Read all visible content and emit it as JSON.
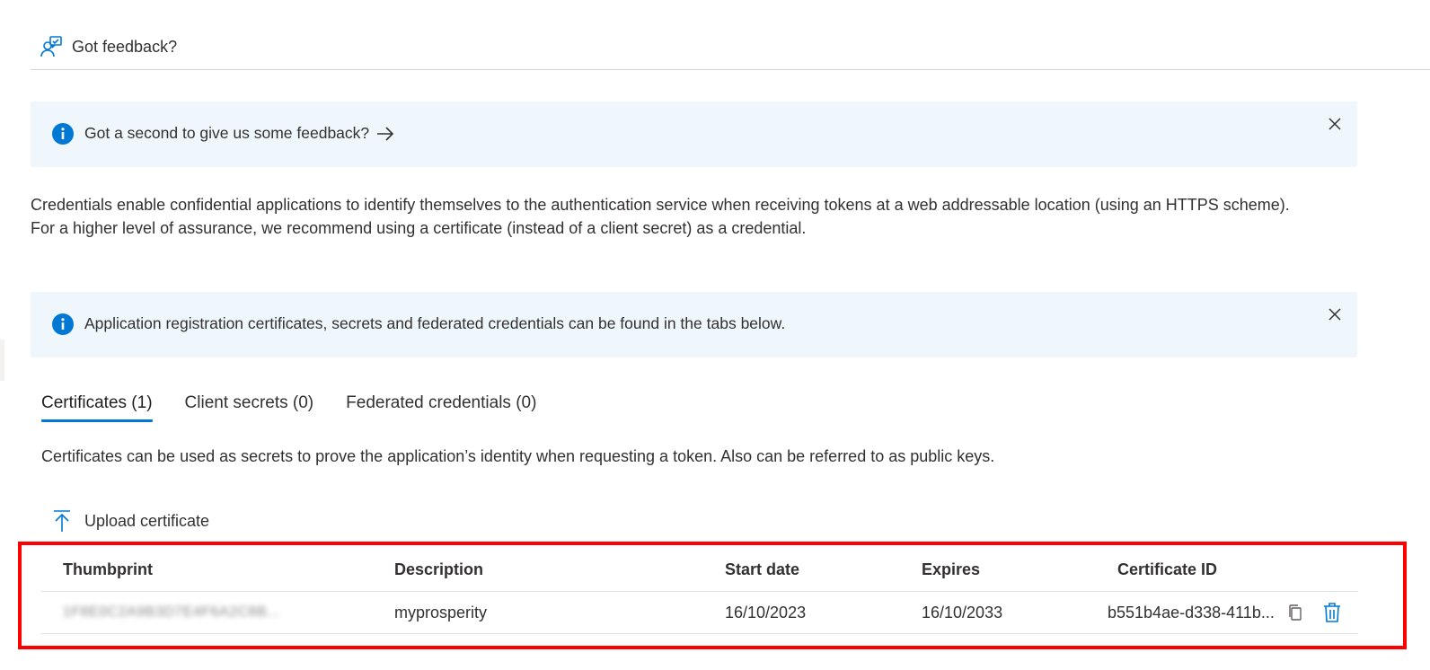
{
  "commandbar": {
    "feedback_label": "Got feedback?"
  },
  "banners": {
    "feedback": {
      "message": "Got a second to give us some feedback?"
    },
    "info": {
      "message": "Application registration certificates, secrets and federated credentials can be found in the tabs below."
    }
  },
  "intro_text": "Credentials enable confidential applications to identify themselves to the authentication service when receiving tokens at a web addressable location (using an HTTPS scheme). For a higher level of assurance, we recommend using a certificate (instead of a client secret) as a credential.",
  "tabs": [
    {
      "label": "Certificates (1)",
      "active": true
    },
    {
      "label": "Client secrets (0)",
      "active": false
    },
    {
      "label": "Federated credentials (0)",
      "active": false
    }
  ],
  "certificates": {
    "description_text": "Certificates can be used as secrets to prove the application’s identity when requesting a token. Also can be referred to as public keys.",
    "upload_label": "Upload certificate",
    "columns": {
      "thumbprint": "Thumbprint",
      "description": "Description",
      "start_date": "Start date",
      "expires": "Expires",
      "certificate_id": "Certificate ID"
    },
    "rows": [
      {
        "thumbprint_masked": "1F8E0C2A9B3D7E4F6A2C8B...",
        "thumbprint_ellipsis": "...",
        "description": "myprosperity",
        "start_date": "16/10/2023",
        "expires": "16/10/2033",
        "certificate_id": "b551b4ae-d338-411b..."
      }
    ]
  },
  "colors": {
    "accent": "#0078d4",
    "banner_bg": "#eff6fc",
    "highlight": "#ff0000"
  }
}
